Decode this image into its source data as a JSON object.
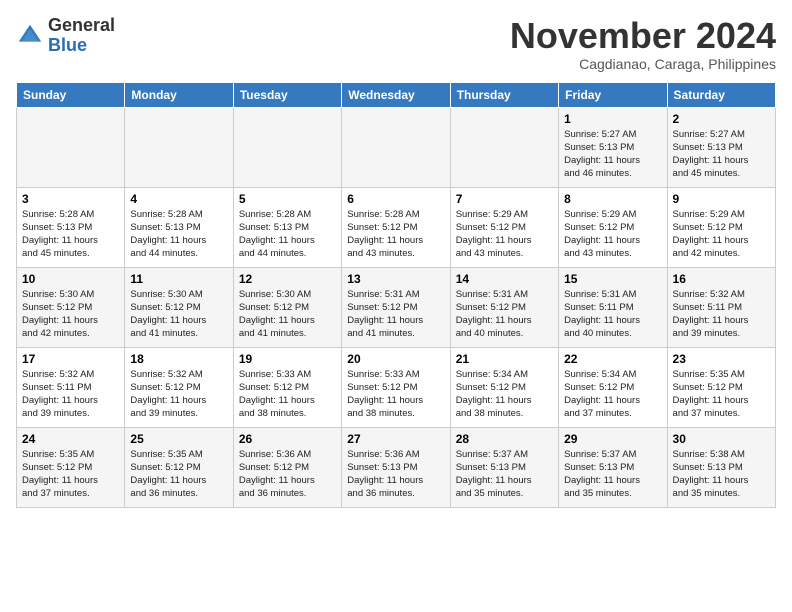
{
  "header": {
    "logo_line1": "General",
    "logo_line2": "Blue",
    "month_title": "November 2024",
    "subtitle": "Cagdianao, Caraga, Philippines"
  },
  "weekdays": [
    "Sunday",
    "Monday",
    "Tuesday",
    "Wednesday",
    "Thursday",
    "Friday",
    "Saturday"
  ],
  "weeks": [
    [
      {
        "day": "",
        "info": ""
      },
      {
        "day": "",
        "info": ""
      },
      {
        "day": "",
        "info": ""
      },
      {
        "day": "",
        "info": ""
      },
      {
        "day": "",
        "info": ""
      },
      {
        "day": "1",
        "info": "Sunrise: 5:27 AM\nSunset: 5:13 PM\nDaylight: 11 hours\nand 46 minutes."
      },
      {
        "day": "2",
        "info": "Sunrise: 5:27 AM\nSunset: 5:13 PM\nDaylight: 11 hours\nand 45 minutes."
      }
    ],
    [
      {
        "day": "3",
        "info": "Sunrise: 5:28 AM\nSunset: 5:13 PM\nDaylight: 11 hours\nand 45 minutes."
      },
      {
        "day": "4",
        "info": "Sunrise: 5:28 AM\nSunset: 5:13 PM\nDaylight: 11 hours\nand 44 minutes."
      },
      {
        "day": "5",
        "info": "Sunrise: 5:28 AM\nSunset: 5:13 PM\nDaylight: 11 hours\nand 44 minutes."
      },
      {
        "day": "6",
        "info": "Sunrise: 5:28 AM\nSunset: 5:12 PM\nDaylight: 11 hours\nand 43 minutes."
      },
      {
        "day": "7",
        "info": "Sunrise: 5:29 AM\nSunset: 5:12 PM\nDaylight: 11 hours\nand 43 minutes."
      },
      {
        "day": "8",
        "info": "Sunrise: 5:29 AM\nSunset: 5:12 PM\nDaylight: 11 hours\nand 43 minutes."
      },
      {
        "day": "9",
        "info": "Sunrise: 5:29 AM\nSunset: 5:12 PM\nDaylight: 11 hours\nand 42 minutes."
      }
    ],
    [
      {
        "day": "10",
        "info": "Sunrise: 5:30 AM\nSunset: 5:12 PM\nDaylight: 11 hours\nand 42 minutes."
      },
      {
        "day": "11",
        "info": "Sunrise: 5:30 AM\nSunset: 5:12 PM\nDaylight: 11 hours\nand 41 minutes."
      },
      {
        "day": "12",
        "info": "Sunrise: 5:30 AM\nSunset: 5:12 PM\nDaylight: 11 hours\nand 41 minutes."
      },
      {
        "day": "13",
        "info": "Sunrise: 5:31 AM\nSunset: 5:12 PM\nDaylight: 11 hours\nand 41 minutes."
      },
      {
        "day": "14",
        "info": "Sunrise: 5:31 AM\nSunset: 5:12 PM\nDaylight: 11 hours\nand 40 minutes."
      },
      {
        "day": "15",
        "info": "Sunrise: 5:31 AM\nSunset: 5:11 PM\nDaylight: 11 hours\nand 40 minutes."
      },
      {
        "day": "16",
        "info": "Sunrise: 5:32 AM\nSunset: 5:11 PM\nDaylight: 11 hours\nand 39 minutes."
      }
    ],
    [
      {
        "day": "17",
        "info": "Sunrise: 5:32 AM\nSunset: 5:11 PM\nDaylight: 11 hours\nand 39 minutes."
      },
      {
        "day": "18",
        "info": "Sunrise: 5:32 AM\nSunset: 5:12 PM\nDaylight: 11 hours\nand 39 minutes."
      },
      {
        "day": "19",
        "info": "Sunrise: 5:33 AM\nSunset: 5:12 PM\nDaylight: 11 hours\nand 38 minutes."
      },
      {
        "day": "20",
        "info": "Sunrise: 5:33 AM\nSunset: 5:12 PM\nDaylight: 11 hours\nand 38 minutes."
      },
      {
        "day": "21",
        "info": "Sunrise: 5:34 AM\nSunset: 5:12 PM\nDaylight: 11 hours\nand 38 minutes."
      },
      {
        "day": "22",
        "info": "Sunrise: 5:34 AM\nSunset: 5:12 PM\nDaylight: 11 hours\nand 37 minutes."
      },
      {
        "day": "23",
        "info": "Sunrise: 5:35 AM\nSunset: 5:12 PM\nDaylight: 11 hours\nand 37 minutes."
      }
    ],
    [
      {
        "day": "24",
        "info": "Sunrise: 5:35 AM\nSunset: 5:12 PM\nDaylight: 11 hours\nand 37 minutes."
      },
      {
        "day": "25",
        "info": "Sunrise: 5:35 AM\nSunset: 5:12 PM\nDaylight: 11 hours\nand 36 minutes."
      },
      {
        "day": "26",
        "info": "Sunrise: 5:36 AM\nSunset: 5:12 PM\nDaylight: 11 hours\nand 36 minutes."
      },
      {
        "day": "27",
        "info": "Sunrise: 5:36 AM\nSunset: 5:13 PM\nDaylight: 11 hours\nand 36 minutes."
      },
      {
        "day": "28",
        "info": "Sunrise: 5:37 AM\nSunset: 5:13 PM\nDaylight: 11 hours\nand 35 minutes."
      },
      {
        "day": "29",
        "info": "Sunrise: 5:37 AM\nSunset: 5:13 PM\nDaylight: 11 hours\nand 35 minutes."
      },
      {
        "day": "30",
        "info": "Sunrise: 5:38 AM\nSunset: 5:13 PM\nDaylight: 11 hours\nand 35 minutes."
      }
    ]
  ]
}
